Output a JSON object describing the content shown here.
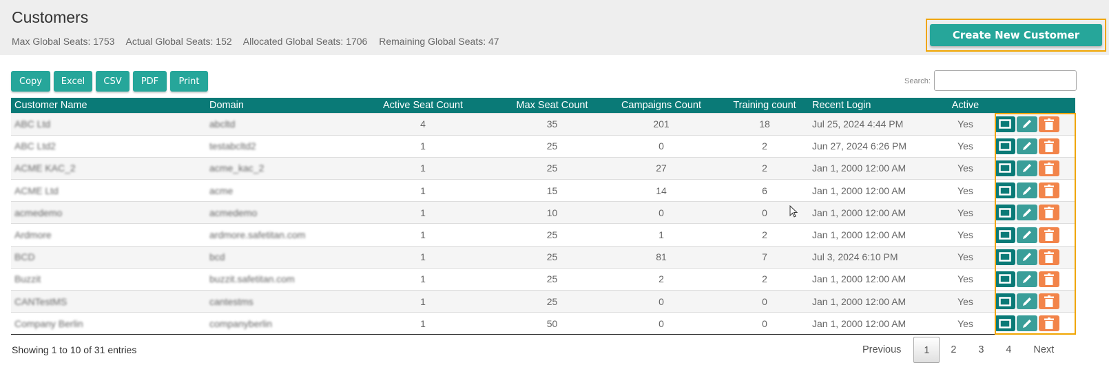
{
  "header": {
    "title": "Customers",
    "stats": [
      "Max Global Seats: 1753",
      "Actual Global Seats: 152",
      "Allocated Global Seats: 1706",
      "Remaining Global Seats: 47"
    ],
    "create_button": "Create New Customer"
  },
  "toolbar": {
    "export_buttons": [
      "Copy",
      "Excel",
      "CSV",
      "PDF",
      "Print"
    ],
    "search_label": "Search:",
    "search_value": ""
  },
  "table": {
    "columns": [
      "Customer Name",
      "Domain",
      "Active Seat Count",
      "Max Seat Count",
      "Campaigns Count",
      "Training count",
      "Recent Login",
      "Active",
      ""
    ],
    "rows": [
      {
        "name": "ABC Ltd",
        "domain": "abcltd",
        "active_seats": "4",
        "max_seats": "35",
        "campaigns": "201",
        "training": "18",
        "recent_login": "Jul 25, 2024 4:44 PM",
        "active": "Yes"
      },
      {
        "name": "ABC Ltd2",
        "domain": "testabcltd2",
        "active_seats": "1",
        "max_seats": "25",
        "campaigns": "0",
        "training": "2",
        "recent_login": "Jun 27, 2024 6:26 PM",
        "active": "Yes"
      },
      {
        "name": "ACME KAC_2",
        "domain": "acme_kac_2",
        "active_seats": "1",
        "max_seats": "25",
        "campaigns": "27",
        "training": "2",
        "recent_login": "Jan 1, 2000 12:00 AM",
        "active": "Yes"
      },
      {
        "name": "ACME Ltd",
        "domain": "acme",
        "active_seats": "1",
        "max_seats": "15",
        "campaigns": "14",
        "training": "6",
        "recent_login": "Jan 1, 2000 12:00 AM",
        "active": "Yes"
      },
      {
        "name": "acmedemo",
        "domain": "acmedemo",
        "active_seats": "1",
        "max_seats": "10",
        "campaigns": "0",
        "training": "0",
        "recent_login": "Jan 1, 2000 12:00 AM",
        "active": "Yes"
      },
      {
        "name": "Ardmore",
        "domain": "ardmore.safetitan.com",
        "active_seats": "1",
        "max_seats": "25",
        "campaigns": "1",
        "training": "2",
        "recent_login": "Jan 1, 2000 12:00 AM",
        "active": "Yes"
      },
      {
        "name": "BCD",
        "domain": "bcd",
        "active_seats": "1",
        "max_seats": "25",
        "campaigns": "81",
        "training": "7",
        "recent_login": "Jul 3, 2024 6:10 PM",
        "active": "Yes"
      },
      {
        "name": "Buzzit",
        "domain": "buzzit.safetitan.com",
        "active_seats": "1",
        "max_seats": "25",
        "campaigns": "2",
        "training": "2",
        "recent_login": "Jan 1, 2000 12:00 AM",
        "active": "Yes"
      },
      {
        "name": "CANTestMS",
        "domain": "cantestms",
        "active_seats": "1",
        "max_seats": "25",
        "campaigns": "0",
        "training": "0",
        "recent_login": "Jan 1, 2000 12:00 AM",
        "active": "Yes"
      },
      {
        "name": "Company Berlin",
        "domain": "companyberlin",
        "active_seats": "1",
        "max_seats": "50",
        "campaigns": "0",
        "training": "0",
        "recent_login": "Jan 1, 2000 12:00 AM",
        "active": "Yes"
      }
    ],
    "row_actions": [
      "view-icon",
      "edit-pencil-icon",
      "delete-trash-icon"
    ]
  },
  "footer": {
    "info": "Showing 1 to 10 of 31 entries",
    "pagination": {
      "previous": "Previous",
      "pages": [
        "1",
        "2",
        "3",
        "4"
      ],
      "current": "1",
      "next": "Next"
    }
  },
  "colors": {
    "primary": "#26a69a",
    "table_header": "#0a7a77",
    "view_button": "#0a7a77",
    "edit_button": "#3a9e99",
    "delete_button": "#f2844a",
    "highlight_outline": "#f0a500"
  }
}
